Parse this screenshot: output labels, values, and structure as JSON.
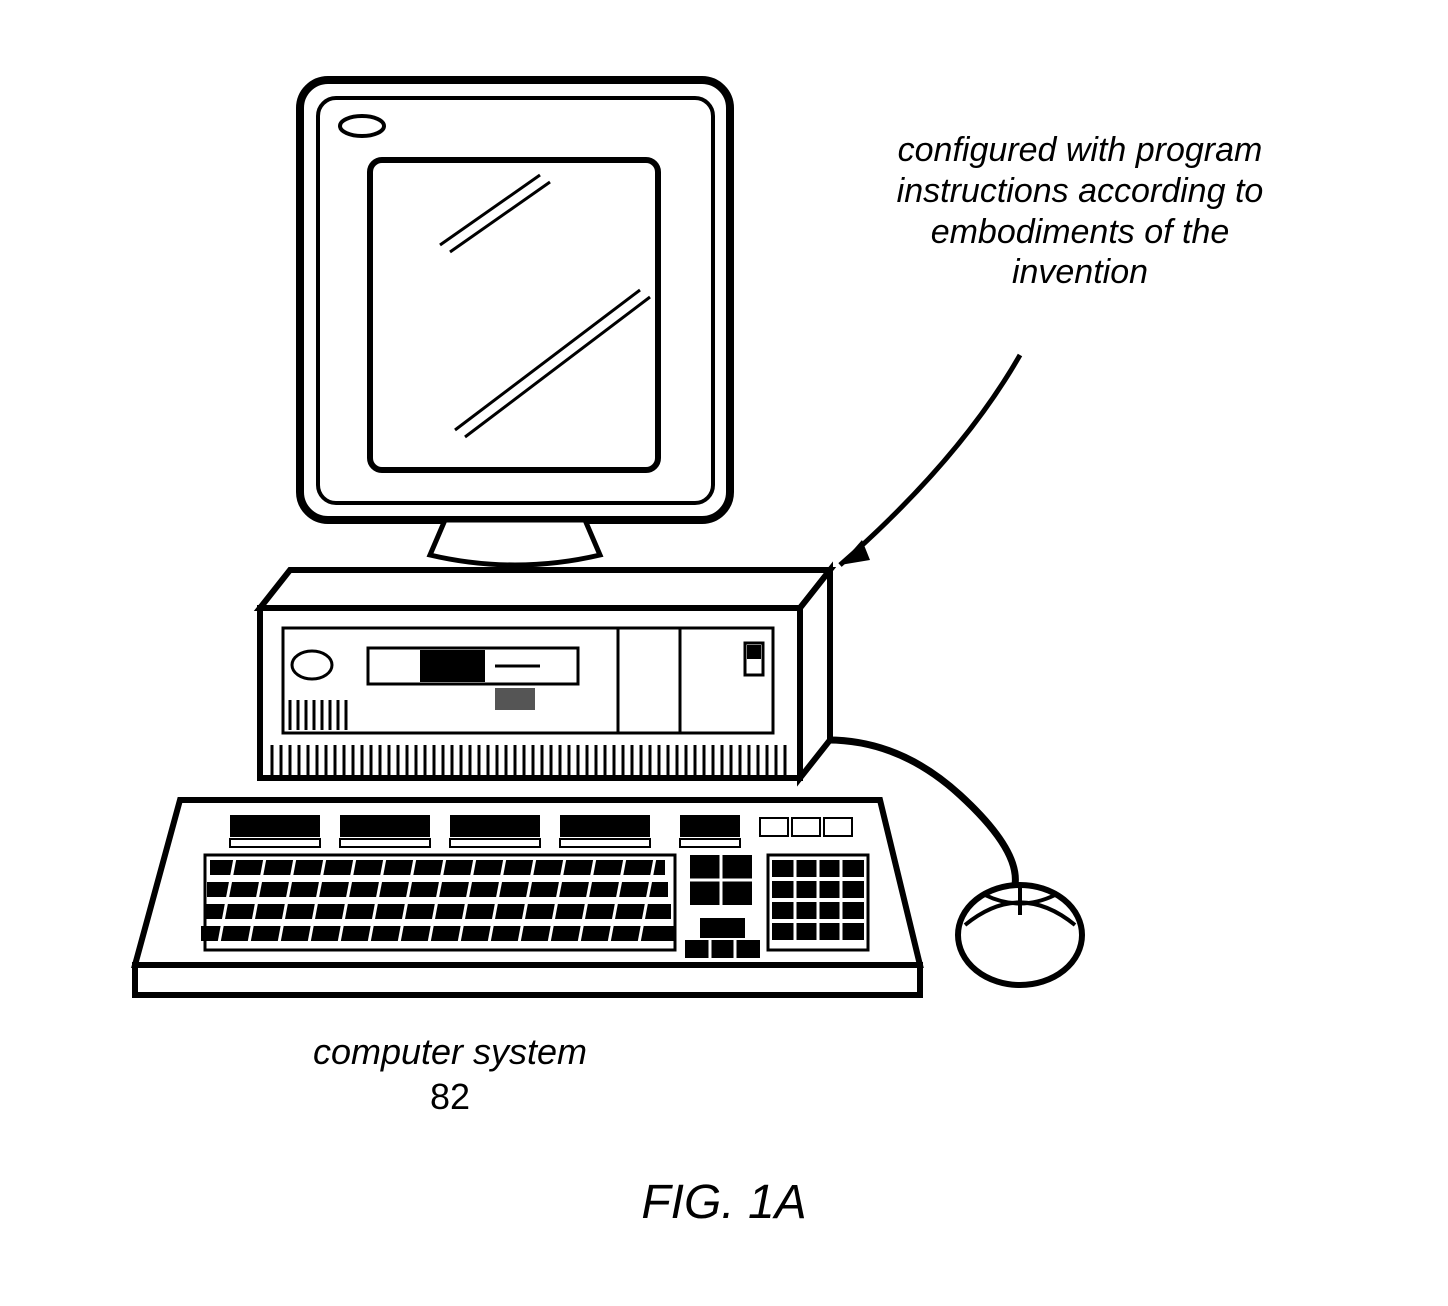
{
  "annotation_text": "configured with program instructions according to embodiments of the invention",
  "component_label": "computer system",
  "reference_number": "82",
  "figure_title": "FIG. 1A"
}
